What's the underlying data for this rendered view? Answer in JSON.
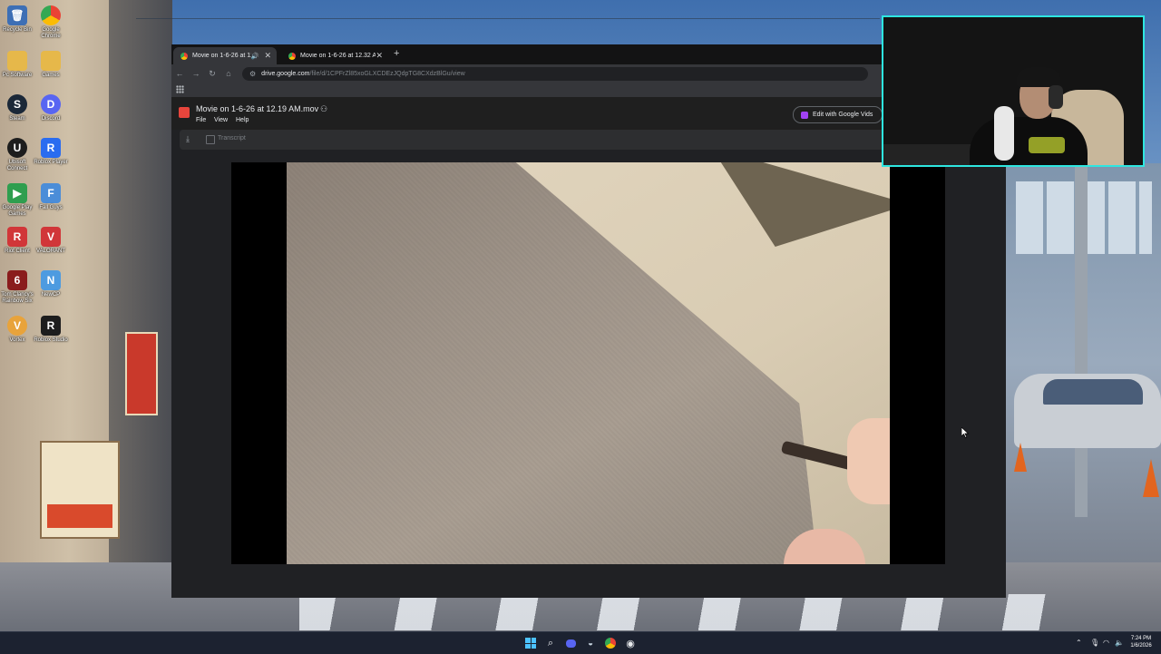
{
  "desktop": {
    "icons": [
      {
        "label": "Recycle Bin",
        "color": "#3d6fb5",
        "glyph": "🗑"
      },
      {
        "label": "Google Chrome",
        "color": "#ffffff",
        "glyph": "◎"
      },
      {
        "label": "Pc Software",
        "color": "#e6b84a",
        "glyph": "▭"
      },
      {
        "label": "Games",
        "color": "#e6b84a",
        "glyph": "▭"
      },
      {
        "label": "Steam",
        "color": "#1b2838",
        "glyph": "S"
      },
      {
        "label": "Discord",
        "color": "#5865f2",
        "glyph": "D"
      },
      {
        "label": "Ubisoft Connect",
        "color": "#1d1d1d",
        "glyph": "U"
      },
      {
        "label": "Roblox Player",
        "color": "#2a6cf0",
        "glyph": "R"
      },
      {
        "label": "Google Play Games",
        "color": "#2f9e4f",
        "glyph": "▶"
      },
      {
        "label": "Fall Guys",
        "color": "#4b8dd8",
        "glyph": "F"
      },
      {
        "label": "Riot Client",
        "color": "#d13639",
        "glyph": "R"
      },
      {
        "label": "VALORANT",
        "color": "#d13639",
        "glyph": "V"
      },
      {
        "label": "Tom Clancy's Rainbow Six",
        "color": "#8a1c1c",
        "glyph": "6"
      },
      {
        "label": "NewCP",
        "color": "#4d9be0",
        "glyph": "N"
      },
      {
        "label": "Vortex",
        "color": "#e8a33b",
        "glyph": "V"
      },
      {
        "label": "Roblox Studio",
        "color": "#1d1d1d",
        "glyph": "R"
      }
    ]
  },
  "browser": {
    "tabs": [
      {
        "title": "Movie on 1-6-26 at 12.19 A",
        "active": true,
        "audio": true
      },
      {
        "title": "Movie on 1-6-26 at 12.32 AM.n",
        "active": false,
        "audio": false
      }
    ],
    "url_host": "drive.google.com",
    "url_path": "/file/d/1CPFrZl85xoGLXCDEzJQdpTG8CXdzBlGu/view",
    "file_title": "Movie on 1-6-26 at 12.19 AM.mov",
    "menu": [
      "File",
      "View",
      "Help"
    ],
    "edit_button": "Edit with Google Vids",
    "transcript_label": "Transcript"
  },
  "taskbar": {
    "time": "7:24 PM",
    "date": "1/6/2026",
    "accent": "#4cc2ff"
  }
}
